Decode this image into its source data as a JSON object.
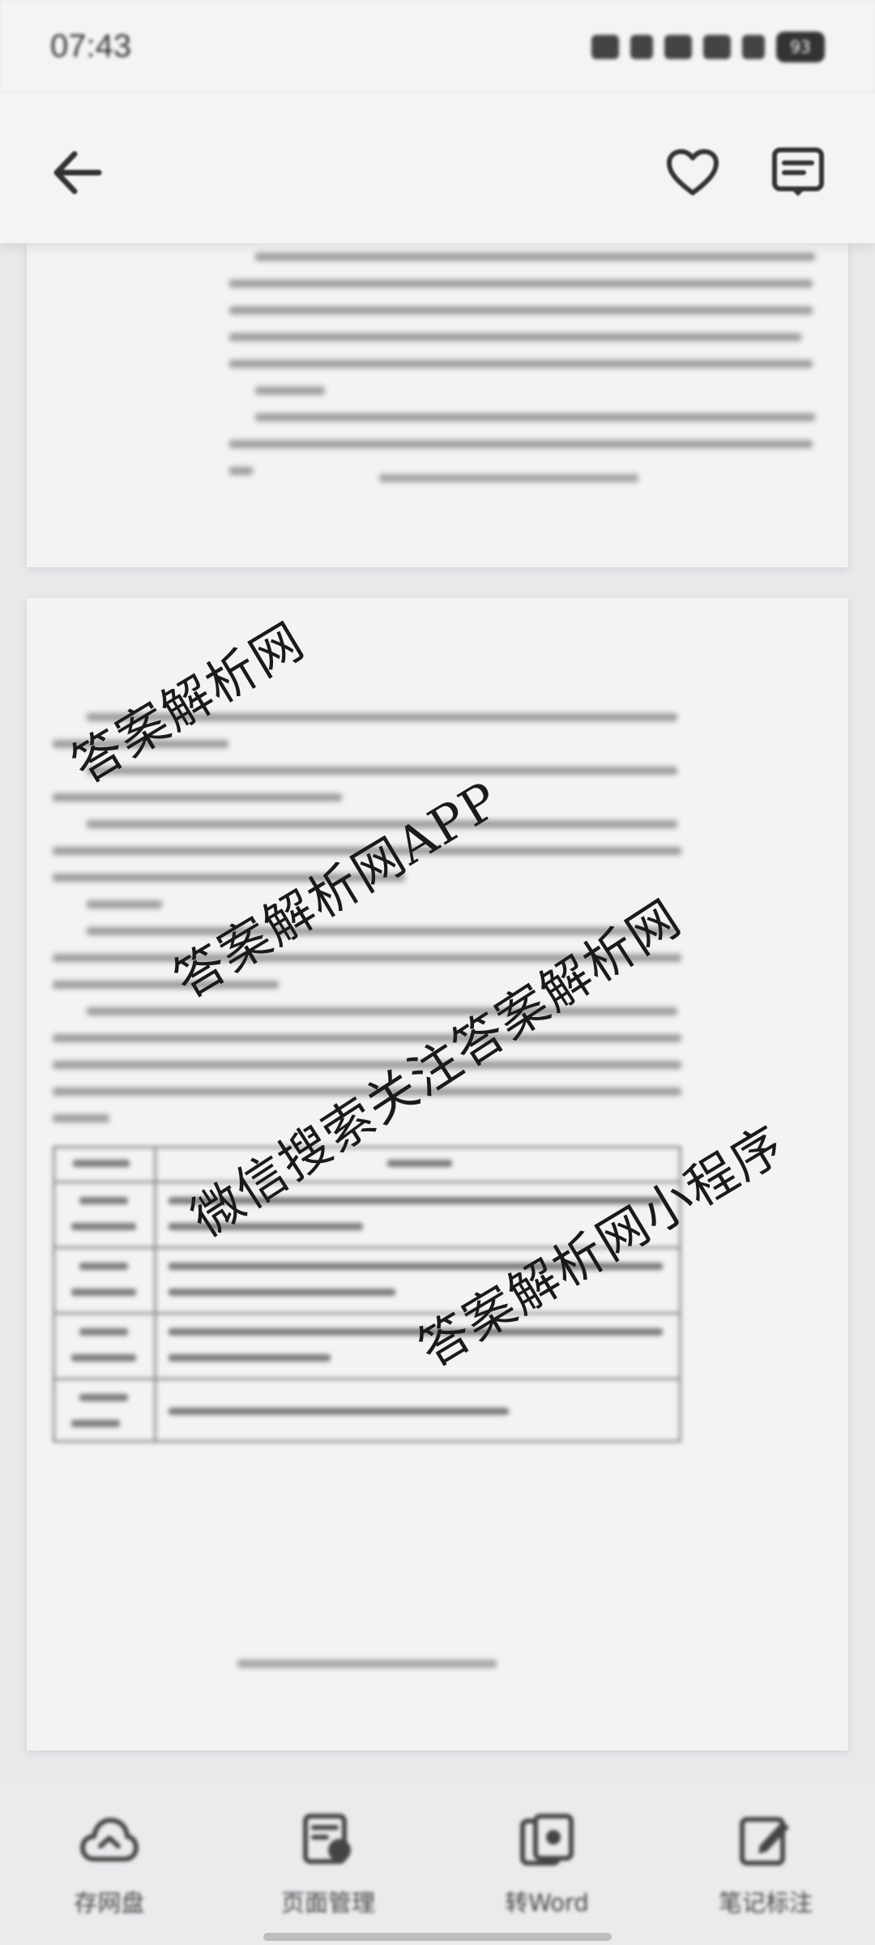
{
  "status_bar": {
    "time": "07:43",
    "battery": "93"
  },
  "nav": {
    "back_icon": "arrow-left-icon",
    "favorite_icon": "heart-icon",
    "menu_icon": "document-menu-icon"
  },
  "watermarks": [
    "答案解析网",
    "答案解析网APP",
    "微信搜索关注答案解析网",
    "答案解析网小程序"
  ],
  "toolbar": {
    "items": [
      {
        "label": "存网盘",
        "icon": "cloud-save-icon"
      },
      {
        "label": "页面管理",
        "icon": "page-manage-icon"
      },
      {
        "label": "转Word",
        "icon": "convert-word-icon"
      },
      {
        "label": "笔记标注",
        "icon": "note-edit-icon"
      }
    ]
  },
  "colors": {
    "background": "#e9e9ec",
    "page": "#f3f3f3",
    "bar": "#f4f4f4"
  }
}
